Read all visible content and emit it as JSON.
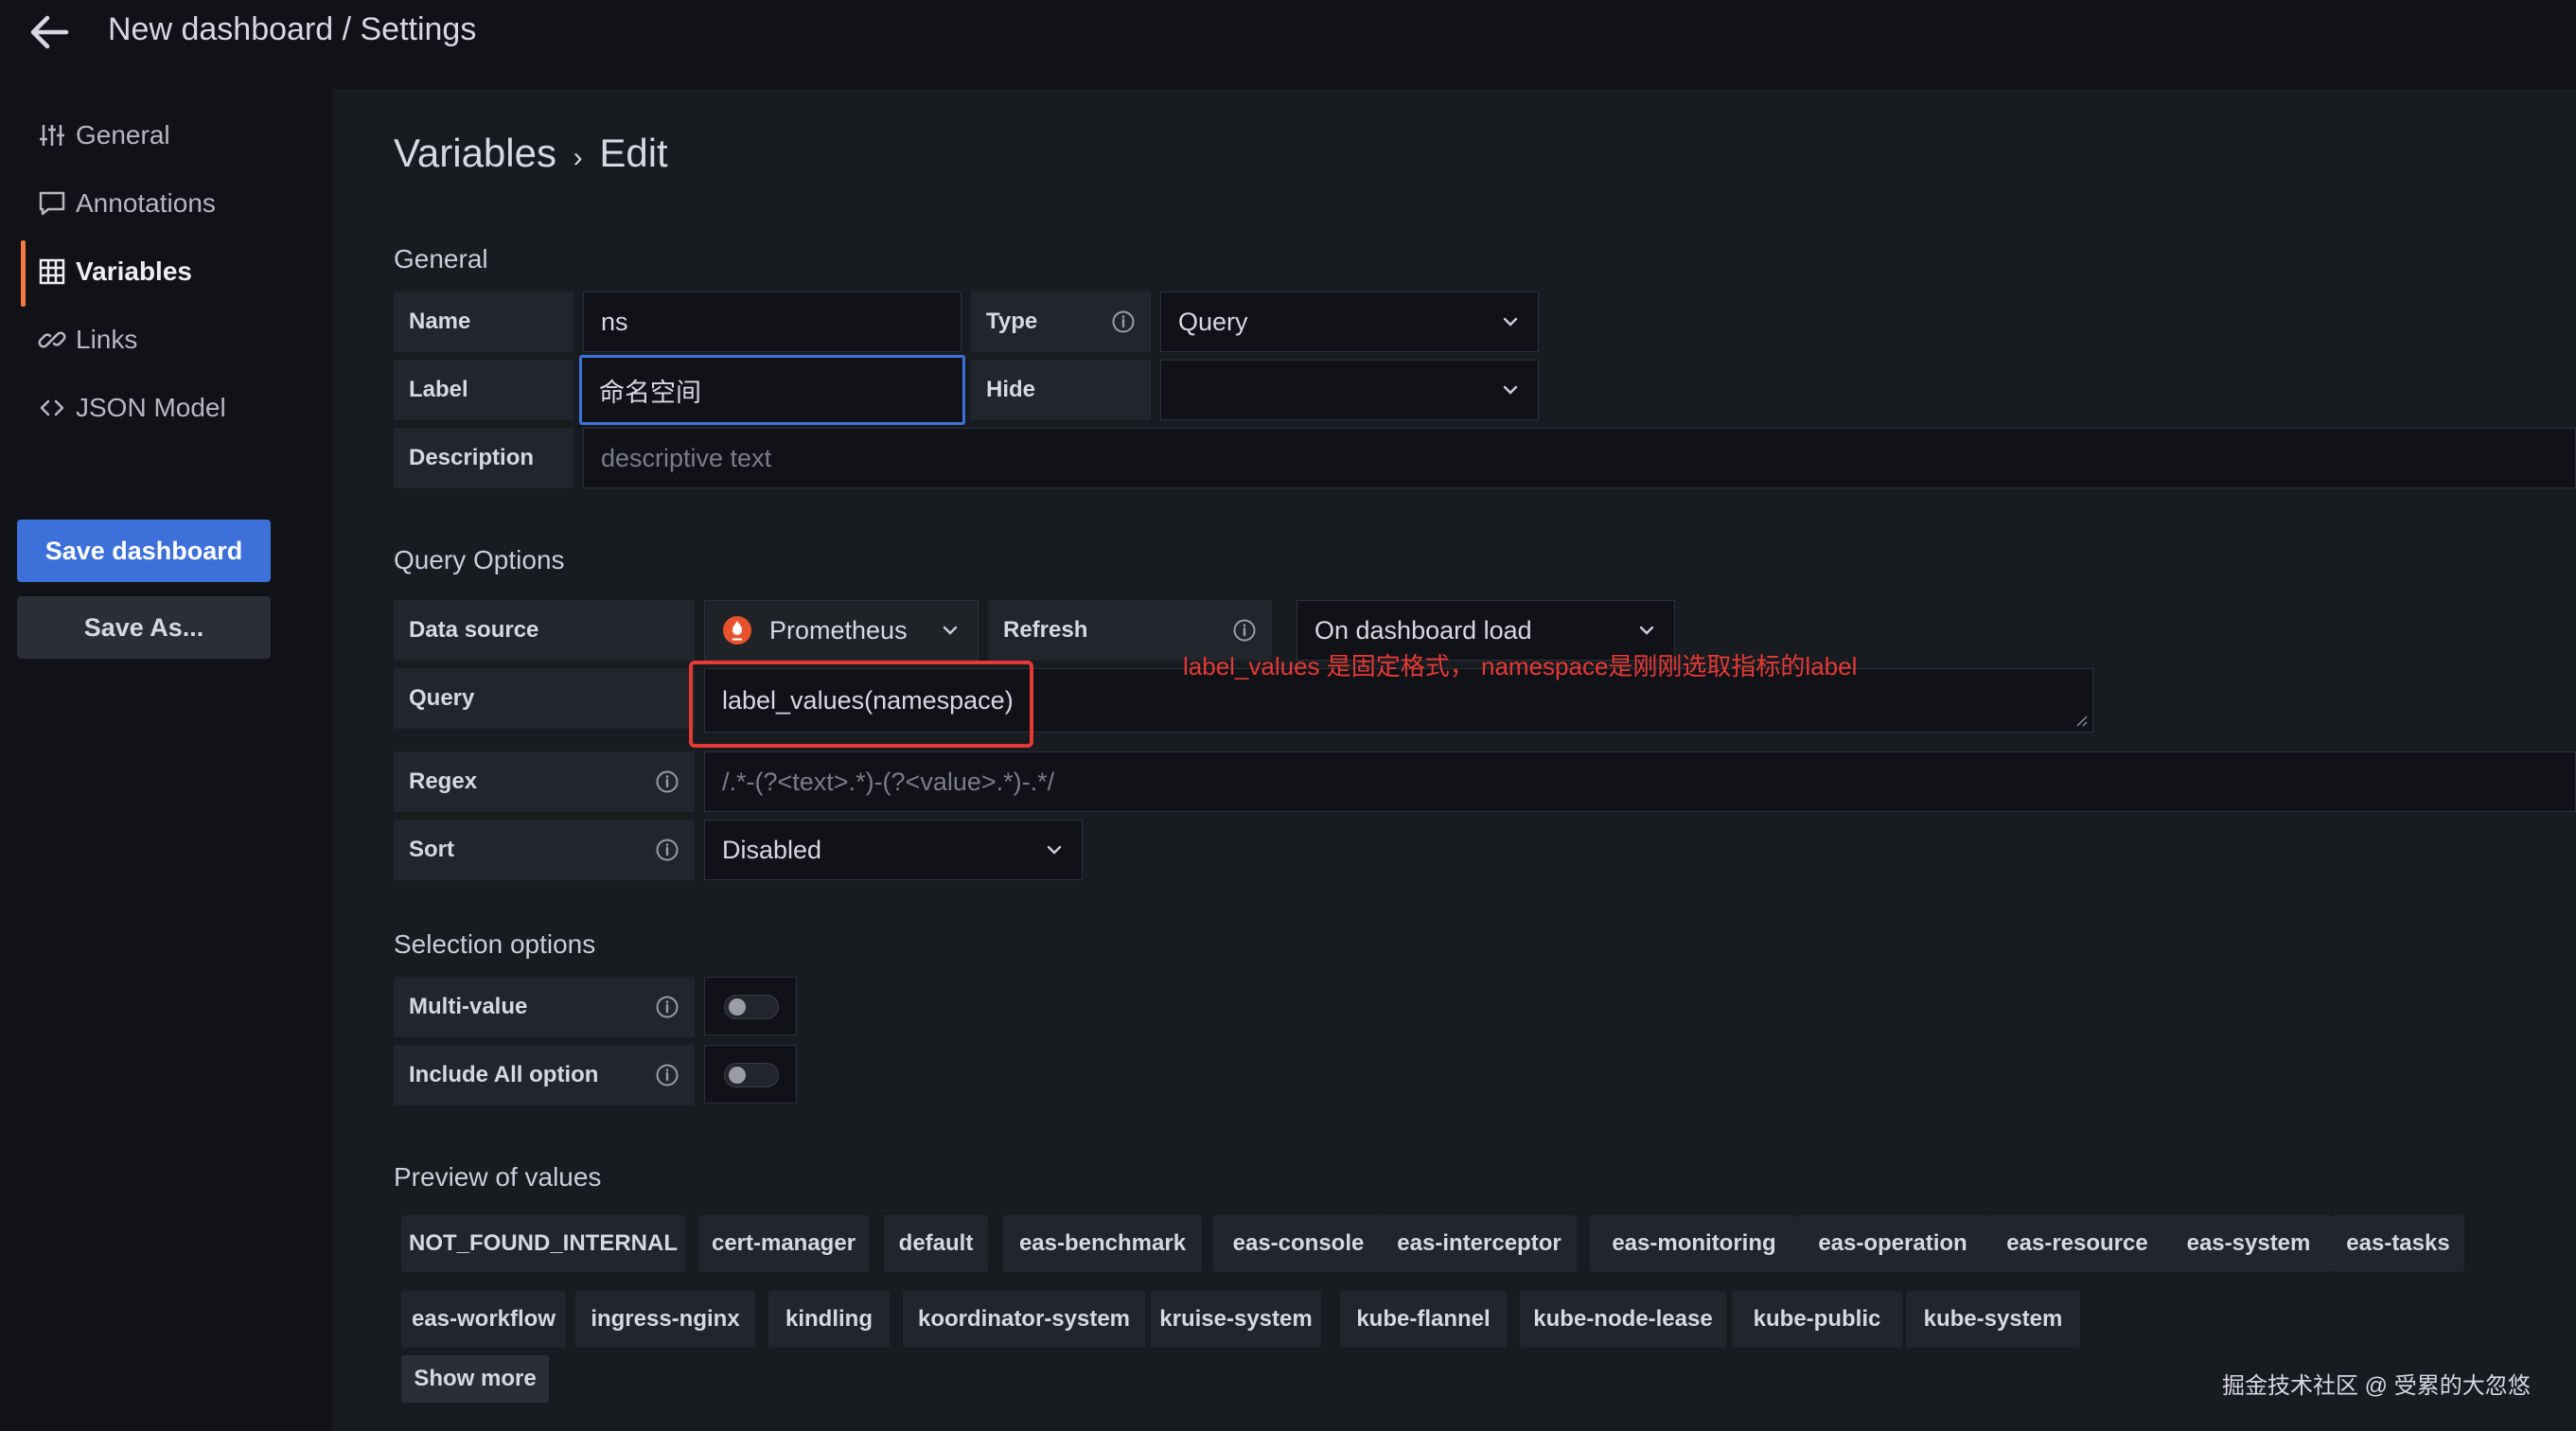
{
  "header": {
    "title": "New dashboard / Settings"
  },
  "sidebar": {
    "items": [
      {
        "label": "General",
        "icon": "sliders-icon"
      },
      {
        "label": "Annotations",
        "icon": "comment-icon"
      },
      {
        "label": "Variables",
        "icon": "table-icon",
        "active": true
      },
      {
        "label": "Links",
        "icon": "link-icon"
      },
      {
        "label": "JSON Model",
        "icon": "code-icon"
      }
    ],
    "save_label": "Save dashboard",
    "save_as_label": "Save As..."
  },
  "main": {
    "heading": {
      "part1": "Variables",
      "separator": "›",
      "part2": "Edit"
    },
    "general": {
      "title": "General",
      "name_label": "Name",
      "name_value": "ns",
      "type_label": "Type",
      "type_value": "Query",
      "label_label": "Label",
      "label_value": "命名空间",
      "hide_label": "Hide",
      "hide_value": "",
      "description_label": "Description",
      "description_placeholder": "descriptive text"
    },
    "query_options": {
      "title": "Query Options",
      "datasource_label": "Data source",
      "datasource_value": "Prometheus",
      "refresh_label": "Refresh",
      "refresh_value": "On dashboard load",
      "query_label": "Query",
      "query_value": "label_values(namespace)",
      "annotation": "label_values 是固定格式， namespace是刚刚选取指标的label",
      "regex_label": "Regex",
      "regex_placeholder": "/.*-(?<text>.*)-(?<value>.*)-.*/",
      "sort_label": "Sort",
      "sort_value": "Disabled"
    },
    "selection": {
      "title": "Selection options",
      "multi_label": "Multi-value",
      "multi_on": false,
      "all_label": "Include All option",
      "all_on": false
    },
    "preview": {
      "title": "Preview of values",
      "values": [
        "NOT_FOUND_INTERNAL",
        "cert-manager",
        "default",
        "eas-benchmark",
        "eas-console",
        "eas-interceptor",
        "eas-monitoring",
        "eas-operation",
        "eas-resource",
        "eas-system",
        "eas-tasks",
        "eas-workflow",
        "ingress-nginx",
        "kindling",
        "koordinator-system",
        "kruise-system",
        "kube-flannel",
        "kube-node-lease",
        "kube-public",
        "kube-system"
      ],
      "show_more": "Show more"
    }
  },
  "watermark": "掘金技术社区 @ 受累的大忽悠",
  "colors": {
    "accent": "#3d71d9",
    "active_marker": "#f47a42",
    "annotation": "#e53935",
    "background": "#181b1f"
  }
}
